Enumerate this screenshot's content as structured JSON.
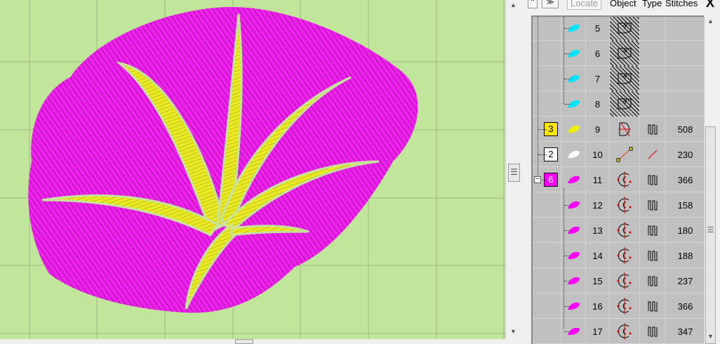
{
  "toolbar": {
    "locate": "Locate",
    "col_object": "Object",
    "col_type": "Type",
    "col_stitches": "Stitches",
    "close": "X",
    "btn_collapse": "⌃",
    "btn_expand": "≫"
  },
  "colors": {
    "canvas": "#c1e59a",
    "magenta": "#ff00ff",
    "yellow": "#f0f000",
    "cyan": "#00e5ff"
  },
  "rows": [
    {
      "group": "",
      "group_color": "",
      "obj_color": "#00e5ff",
      "num": "5",
      "type": "fill-hidden",
      "stitch": "",
      "count": ""
    },
    {
      "group": "",
      "group_color": "",
      "obj_color": "#00e5ff",
      "num": "6",
      "type": "fill-hidden",
      "stitch": "",
      "count": ""
    },
    {
      "group": "",
      "group_color": "",
      "obj_color": "#00e5ff",
      "num": "7",
      "type": "fill-hidden",
      "stitch": "",
      "count": ""
    },
    {
      "group": "",
      "group_color": "",
      "obj_color": "#00e5ff",
      "num": "8",
      "type": "fill-hidden",
      "stitch": "",
      "count": ""
    },
    {
      "group": "3",
      "group_color": "#ffe600",
      "obj_color": "#f0f000",
      "num": "9",
      "type": "fill",
      "stitch": "satin",
      "count": "508"
    },
    {
      "group": "2",
      "group_color": "#ffffff",
      "obj_color": "#ffffff",
      "num": "10",
      "type": "line",
      "stitch": "run",
      "count": "230"
    },
    {
      "group": "6",
      "group_color": "#ff00ff",
      "obj_color": "#ff00ff",
      "num": "11",
      "type": "complex",
      "stitch": "satin",
      "count": "366"
    },
    {
      "group": "",
      "group_color": "",
      "obj_color": "#ff00ff",
      "num": "12",
      "type": "complex",
      "stitch": "satin",
      "count": "158"
    },
    {
      "group": "",
      "group_color": "",
      "obj_color": "#ff00ff",
      "num": "13",
      "type": "complex",
      "stitch": "satin",
      "count": "180"
    },
    {
      "group": "",
      "group_color": "",
      "obj_color": "#ff00ff",
      "num": "14",
      "type": "complex",
      "stitch": "satin",
      "count": "188"
    },
    {
      "group": "",
      "group_color": "",
      "obj_color": "#ff00ff",
      "num": "15",
      "type": "complex",
      "stitch": "satin",
      "count": "237"
    },
    {
      "group": "",
      "group_color": "",
      "obj_color": "#ff00ff",
      "num": "16",
      "type": "complex",
      "stitch": "satin",
      "count": "366"
    },
    {
      "group": "",
      "group_color": "",
      "obj_color": "#ff00ff",
      "num": "17",
      "type": "complex",
      "stitch": "satin",
      "count": "347"
    }
  ]
}
